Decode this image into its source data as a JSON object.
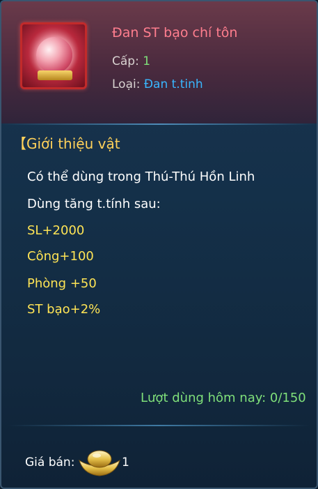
{
  "item": {
    "name": "Đan ST bạo chí tôn",
    "level_label": "Cấp:",
    "level_value": "1",
    "type_label": "Loại:",
    "type_value": "Đan t.tinh",
    "icon": "dragon-orb-icon"
  },
  "section": {
    "title": "【Giới thiệu vật"
  },
  "description": {
    "line1": "Có thể dùng trong Thú-Thú Hồn Linh",
    "line2": "Dùng tăng t.tính sau:"
  },
  "stats": [
    "SL+2000",
    "Công+100",
    "Phòng +50",
    "ST bạo+2%"
  ],
  "usage": "Lượt dùng hôm nay: 0/150",
  "price": {
    "label": "Giá bán:",
    "value": "1",
    "icon": "gold-ingot-icon"
  },
  "colors": {
    "title": "#ff7e8e",
    "level": "#7fe07a",
    "type": "#39b7ff",
    "section": "#ffd15a",
    "stat": "#ffe455",
    "usage": "#7fe07a"
  }
}
